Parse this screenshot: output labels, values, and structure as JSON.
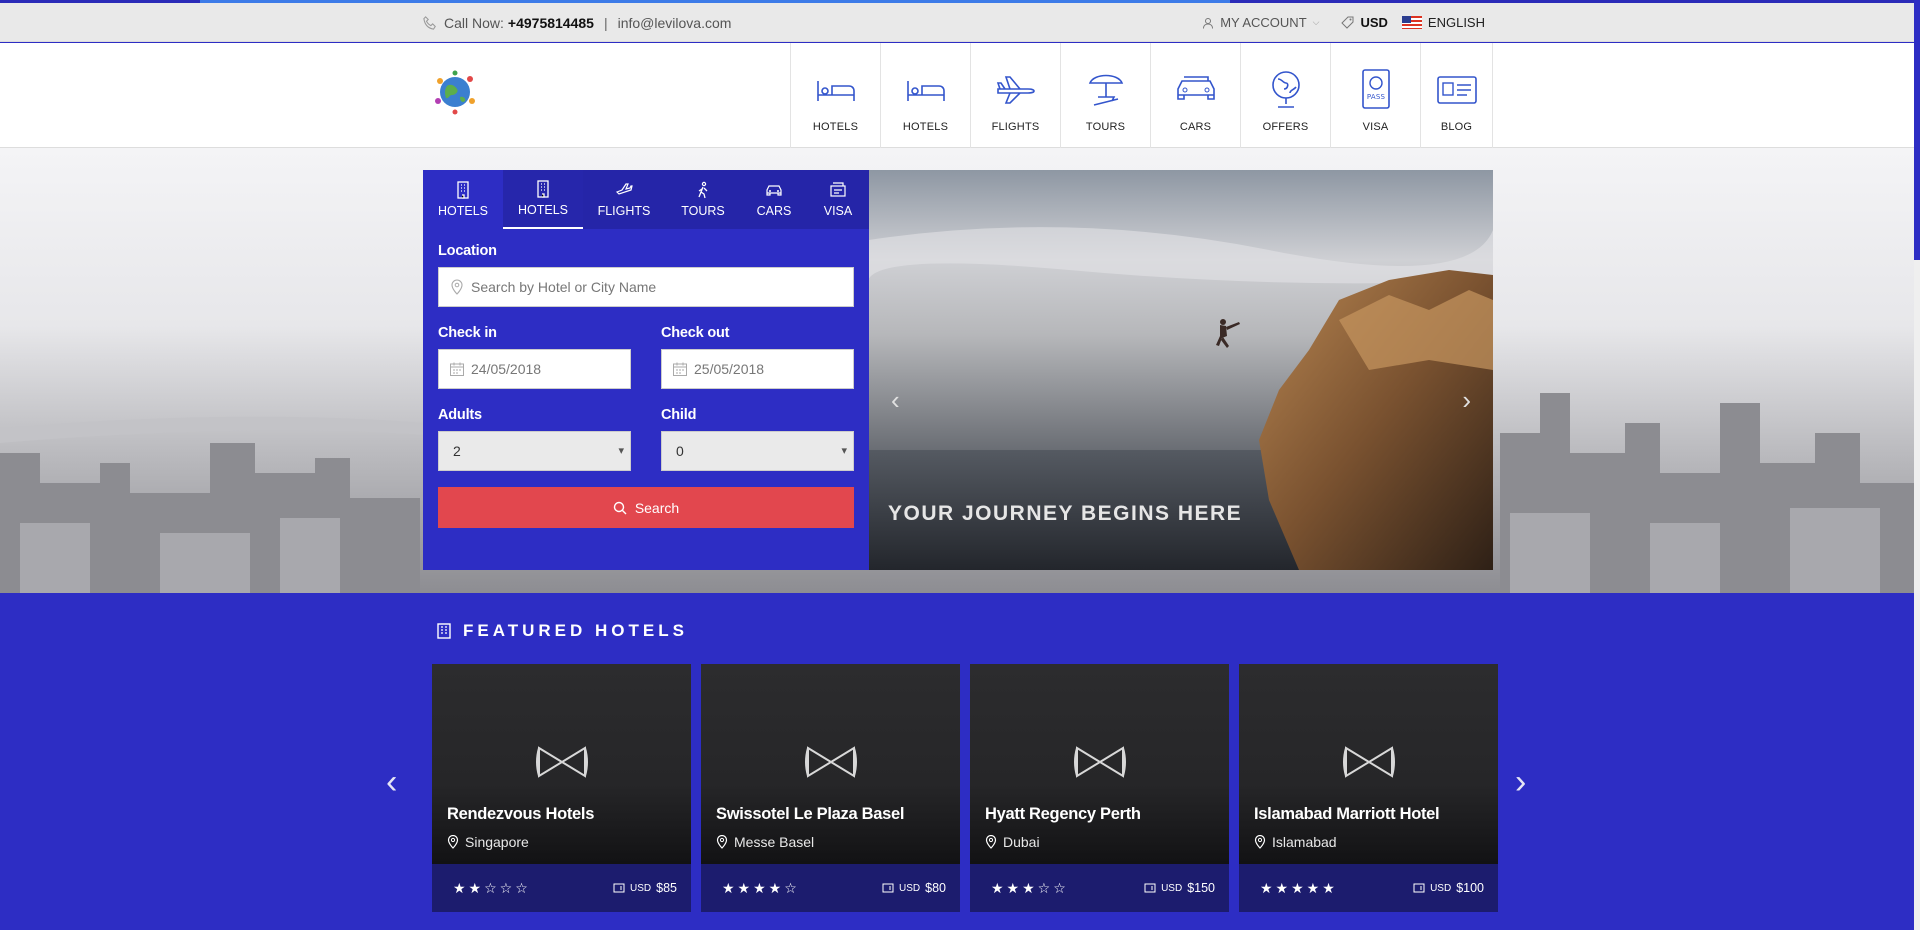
{
  "topbar": {
    "call_label": "Call Now:",
    "phone": "+4975814485",
    "separator": "|",
    "email": "info@levilova.com",
    "account": "MY ACCOUNT",
    "currency": "USD",
    "language": "ENGLISH"
  },
  "nav": {
    "items": [
      {
        "label": "HOTELS",
        "icon": "bed-icon"
      },
      {
        "label": "HOTELS",
        "icon": "bed-icon"
      },
      {
        "label": "FLIGHTS",
        "icon": "plane-icon"
      },
      {
        "label": "TOURS",
        "icon": "beach-umbrella-icon"
      },
      {
        "label": "CARS",
        "icon": "car-icon"
      },
      {
        "label": "OFFERS",
        "icon": "globe-icon"
      },
      {
        "label": "VISA",
        "icon": "passport-icon"
      },
      {
        "label": "BLOG",
        "icon": "id-card-icon"
      }
    ]
  },
  "search": {
    "tabs": [
      {
        "label": "HOTELS",
        "icon": "building-icon"
      },
      {
        "label": "HOTELS",
        "icon": "building-icon"
      },
      {
        "label": "FLIGHTS",
        "icon": "plane-icon"
      },
      {
        "label": "TOURS",
        "icon": "hiker-icon"
      },
      {
        "label": "CARS",
        "icon": "car-icon"
      },
      {
        "label": "VISA",
        "icon": "visa-icon"
      }
    ],
    "location_label": "Location",
    "location_placeholder": "Search by Hotel or City Name",
    "checkin_label": "Check in",
    "checkin_value": "24/05/2018",
    "checkout_label": "Check out",
    "checkout_value": "25/05/2018",
    "adults_label": "Adults",
    "adults_value": "2",
    "child_label": "Child",
    "child_value": "0",
    "button": "Search"
  },
  "slider": {
    "caption": "YOUR JOURNEY BEGINS HERE",
    "prev": "‹",
    "next": "›"
  },
  "featured": {
    "title": "FEATURED HOTELS",
    "prev": "‹",
    "next": "›",
    "hotels": [
      {
        "name": "Rendezvous Hotels",
        "location": "Singapore",
        "stars": "★★☆☆☆",
        "currency": "USD",
        "price": "$85"
      },
      {
        "name": "Swissotel Le Plaza Basel",
        "location": "Messe Basel",
        "stars": "★★★★☆",
        "currency": "USD",
        "price": "$80"
      },
      {
        "name": "Hyatt Regency Perth",
        "location": "Dubai",
        "stars": "★★★☆☆",
        "currency": "USD",
        "price": "$150"
      },
      {
        "name": "Islamabad Marriott Hotel",
        "location": "Islamabad",
        "stars": "★★★★★",
        "currency": "USD",
        "price": "$100"
      }
    ]
  },
  "colors": {
    "primary": "#2d2dc4",
    "accent": "#e2474e",
    "progress": "#3d7be8"
  }
}
